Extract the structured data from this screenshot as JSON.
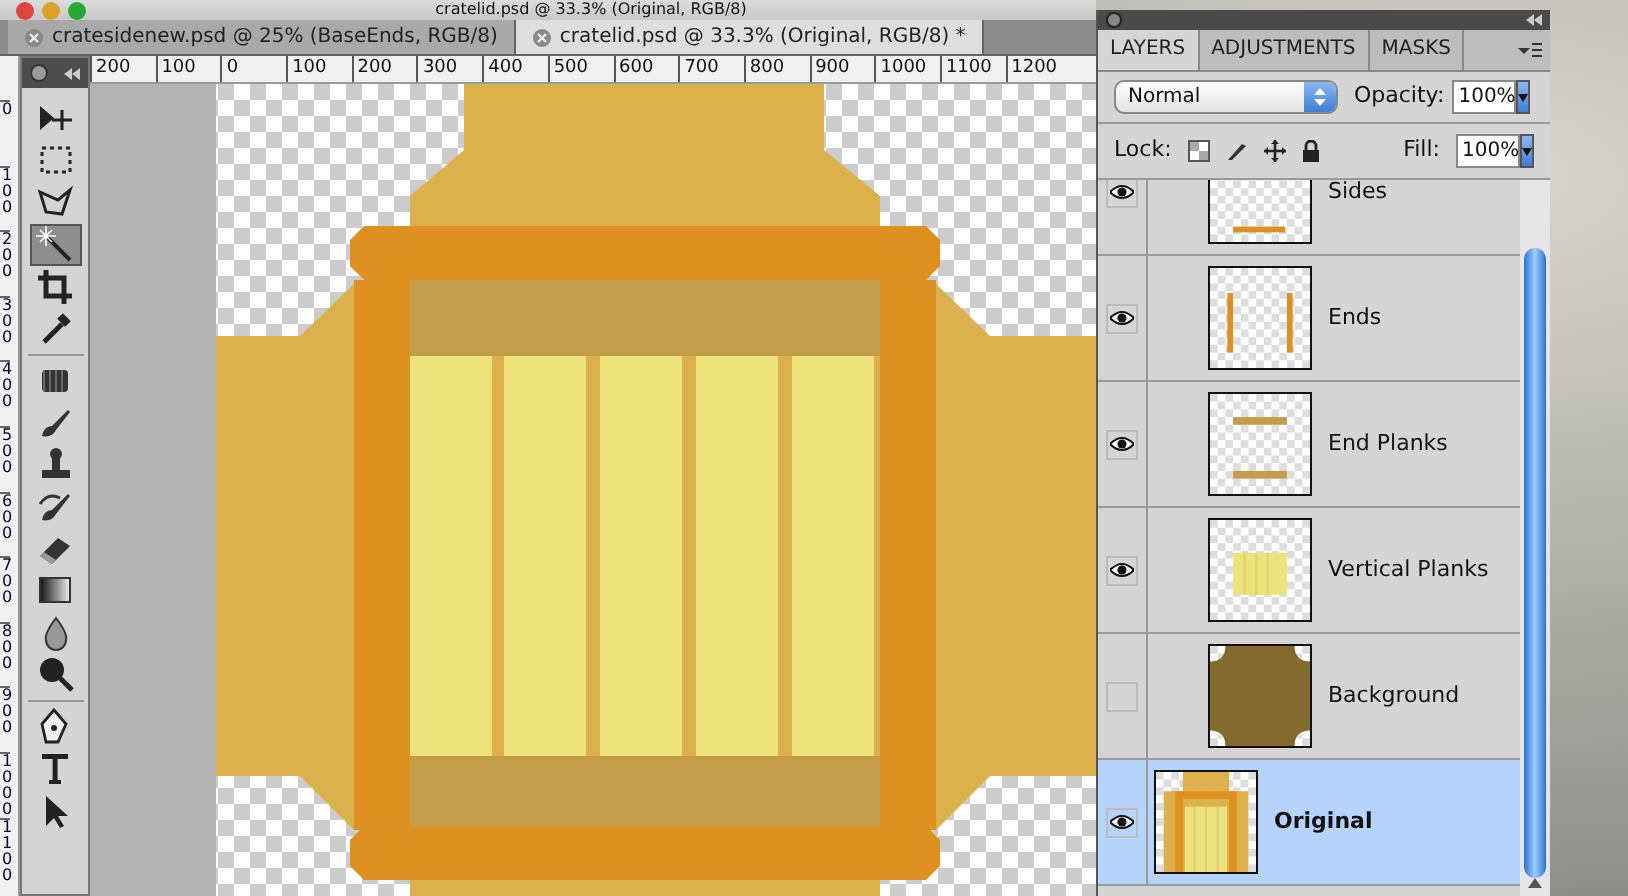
{
  "window": {
    "title": "cratelid.psd @ 33.3% (Original, RGB/8)"
  },
  "document_tabs": [
    {
      "label": "cratesidenew.psd @ 25% (BaseEnds, RGB/8)",
      "selected": false
    },
    {
      "label": "cratelid.psd @ 33.3% (Original, RGB/8) *",
      "selected": true
    }
  ],
  "ruler_horizontal": [
    "200",
    "100",
    "0",
    "100",
    "200",
    "300",
    "400",
    "500",
    "600",
    "700",
    "800",
    "900",
    "1000",
    "1100",
    "1200"
  ],
  "ruler_vertical": [
    "0",
    "100",
    "200",
    "300",
    "400",
    "500",
    "600",
    "700",
    "800",
    "900",
    "1000",
    "1100"
  ],
  "tools": [
    {
      "kind": "move",
      "selected": false
    },
    {
      "kind": "marquee",
      "selected": false
    },
    {
      "kind": "lasso",
      "selected": false
    },
    {
      "kind": "wand",
      "selected": true
    },
    {
      "kind": "crop",
      "selected": false
    },
    {
      "kind": "eyedropper",
      "selected": false
    },
    {
      "kind": "heal",
      "selected": false
    },
    {
      "kind": "brush",
      "selected": false
    },
    {
      "kind": "stamp",
      "selected": false
    },
    {
      "kind": "history",
      "selected": false
    },
    {
      "kind": "eraser",
      "selected": false
    },
    {
      "kind": "gradient",
      "selected": false
    },
    {
      "kind": "blur",
      "selected": false
    },
    {
      "kind": "dodge",
      "selected": false
    },
    {
      "kind": "pen",
      "selected": false
    },
    {
      "kind": "type",
      "selected": false
    },
    {
      "kind": "select",
      "selected": false
    }
  ],
  "layers_panel": {
    "tabs": [
      {
        "label": "LAYERS",
        "selected": true
      },
      {
        "label": "ADJUSTMENTS",
        "selected": false
      },
      {
        "label": "MASKS",
        "selected": false
      }
    ],
    "blend_mode": "Normal",
    "opacity_label": "Opacity:",
    "opacity": "100%",
    "lock_label": "Lock:",
    "fill_label": "Fill:",
    "fill": "100%",
    "layers": [
      {
        "name": "Sides",
        "kind": "sides",
        "visible": true,
        "selected": false
      },
      {
        "name": "Ends",
        "kind": "ends",
        "visible": true,
        "selected": false
      },
      {
        "name": "End Planks",
        "kind": "end_planks",
        "visible": true,
        "selected": false
      },
      {
        "name": "Vertical Planks",
        "kind": "vertical_planks",
        "visible": true,
        "selected": false
      },
      {
        "name": "Background",
        "kind": "background",
        "visible": false,
        "selected": false
      },
      {
        "name": "Original",
        "kind": "original",
        "visible": true,
        "selected": true
      }
    ]
  }
}
